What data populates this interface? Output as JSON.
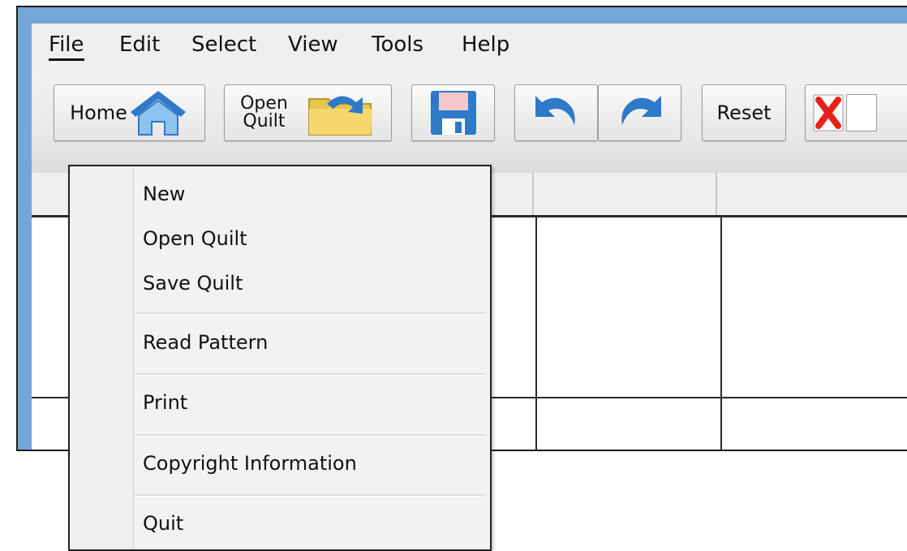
{
  "menubar": {
    "file": "File",
    "edit": "Edit",
    "select": "Select",
    "view": "View",
    "tools": "Tools",
    "help": "Help"
  },
  "toolbar": {
    "home_label": "Home",
    "open_label_line1": "Open",
    "open_label_line2": "Quilt",
    "reset_label": "Reset",
    "icons": [
      "home-icon",
      "folder-icon",
      "save-icon",
      "undo-icon",
      "redo-icon",
      "close-icon"
    ],
    "accent_blue": "#2f79c9",
    "folder_yellow": "#f5d76e",
    "close_red": "#e8201a"
  },
  "file_menu": {
    "items": [
      "New",
      "Open Quilt",
      "Save Quilt",
      "Read Pattern",
      "Print",
      "Copyright Information",
      "Quit"
    ]
  }
}
